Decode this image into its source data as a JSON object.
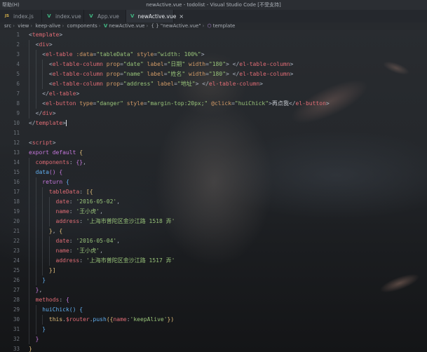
{
  "titlebar": {
    "menu": "帮助(H)",
    "window_title": "newActive.vue - todolist - Visual Studio Code [不受支持]"
  },
  "tabs": [
    {
      "label": "index.js",
      "icon": "js-file-icon",
      "active": false
    },
    {
      "label": "index.vue",
      "icon": "vue-file-icon",
      "active": false
    },
    {
      "label": "App.vue",
      "icon": "vue-file-icon",
      "active": false
    },
    {
      "label": "newActive.vue",
      "icon": "vue-file-icon",
      "active": true
    }
  ],
  "breadcrumb": {
    "items": [
      "src",
      "view",
      "keep-alive",
      "components"
    ],
    "file": "newActive.vue",
    "symbol_prefix": "{ }",
    "symbol": "\"newActive.vue\"",
    "last": "template"
  },
  "editor": {
    "lines": [
      {
        "n": "1",
        "tokens": [
          [
            "t-punc",
            "<"
          ],
          [
            "t-tag",
            "template"
          ],
          [
            "t-punc",
            ">"
          ]
        ]
      },
      {
        "n": "2",
        "tokens": [
          [
            "",
            "  "
          ],
          [
            "t-punc",
            "<"
          ],
          [
            "t-tag",
            "div"
          ],
          [
            "t-punc",
            ">"
          ]
        ]
      },
      {
        "n": "3",
        "tokens": [
          [
            "",
            "    "
          ],
          [
            "t-punc",
            "<"
          ],
          [
            "t-tag",
            "el-table"
          ],
          [
            "t-attr",
            " :data"
          ],
          [
            "t-punc",
            "="
          ],
          [
            "t-str",
            "\"tableData\""
          ],
          [
            "t-attr",
            " style"
          ],
          [
            "t-punc",
            "="
          ],
          [
            "t-str",
            "\"width: 100%\""
          ],
          [
            "t-punc",
            ">"
          ]
        ]
      },
      {
        "n": "4",
        "tokens": [
          [
            "",
            "      "
          ],
          [
            "t-punc",
            "<"
          ],
          [
            "t-tag",
            "el-table-column"
          ],
          [
            "t-attr",
            " prop"
          ],
          [
            "t-punc",
            "="
          ],
          [
            "t-str",
            "\"date\""
          ],
          [
            "t-attr",
            " label"
          ],
          [
            "t-punc",
            "="
          ],
          [
            "t-str",
            "\"日期\""
          ],
          [
            "t-attr",
            " width"
          ],
          [
            "t-punc",
            "="
          ],
          [
            "t-str",
            "\"180\""
          ],
          [
            "t-punc",
            "> </"
          ],
          [
            "t-tag",
            "el-table-column"
          ],
          [
            "t-punc",
            ">"
          ]
        ]
      },
      {
        "n": "5",
        "tokens": [
          [
            "",
            "      "
          ],
          [
            "t-punc",
            "<"
          ],
          [
            "t-tag",
            "el-table-column"
          ],
          [
            "t-attr",
            " prop"
          ],
          [
            "t-punc",
            "="
          ],
          [
            "t-str",
            "\"name\""
          ],
          [
            "t-attr",
            " label"
          ],
          [
            "t-punc",
            "="
          ],
          [
            "t-str",
            "\"姓名\""
          ],
          [
            "t-attr",
            " width"
          ],
          [
            "t-punc",
            "="
          ],
          [
            "t-str",
            "\"180\""
          ],
          [
            "t-punc",
            "> </"
          ],
          [
            "t-tag",
            "el-table-column"
          ],
          [
            "t-punc",
            ">"
          ]
        ]
      },
      {
        "n": "6",
        "tokens": [
          [
            "",
            "      "
          ],
          [
            "t-punc",
            "<"
          ],
          [
            "t-tag",
            "el-table-column"
          ],
          [
            "t-attr",
            " prop"
          ],
          [
            "t-punc",
            "="
          ],
          [
            "t-str",
            "\"address\""
          ],
          [
            "t-attr",
            " label"
          ],
          [
            "t-punc",
            "="
          ],
          [
            "t-str",
            "\"地址\""
          ],
          [
            "t-punc",
            "> </"
          ],
          [
            "t-tag",
            "el-table-column"
          ],
          [
            "t-punc",
            ">"
          ]
        ]
      },
      {
        "n": "7",
        "tokens": [
          [
            "",
            "    "
          ],
          [
            "t-punc",
            "</"
          ],
          [
            "t-tag",
            "el-table"
          ],
          [
            "t-punc",
            ">"
          ]
        ]
      },
      {
        "n": "8",
        "tokens": [
          [
            "",
            "    "
          ],
          [
            "t-punc",
            "<"
          ],
          [
            "t-tag",
            "el-button"
          ],
          [
            "t-attr",
            " type"
          ],
          [
            "t-punc",
            "="
          ],
          [
            "t-str",
            "\"danger\""
          ],
          [
            "t-attr",
            " style"
          ],
          [
            "t-punc",
            "="
          ],
          [
            "t-str",
            "\"margin-top:20px;\""
          ],
          [
            "t-attr",
            " @click"
          ],
          [
            "t-punc",
            "="
          ],
          [
            "t-str",
            "\"huiChick\""
          ],
          [
            "t-punc",
            ">"
          ],
          [
            "t-text",
            "再点我"
          ],
          [
            "t-punc",
            "</"
          ],
          [
            "t-tag",
            "el-button"
          ],
          [
            "t-punc",
            ">"
          ]
        ]
      },
      {
        "n": "9",
        "tokens": [
          [
            "",
            "  "
          ],
          [
            "t-punc",
            "</"
          ],
          [
            "t-tag",
            "div"
          ],
          [
            "t-punc",
            ">"
          ]
        ]
      },
      {
        "n": "10",
        "tokens": [
          [
            "t-punc",
            "</"
          ],
          [
            "t-tag",
            "template"
          ],
          [
            "t-punc t-cursor",
            ">"
          ]
        ]
      },
      {
        "n": "11",
        "tokens": []
      },
      {
        "n": "12",
        "tokens": [
          [
            "t-punc",
            "<"
          ],
          [
            "t-tag",
            "script"
          ],
          [
            "t-punc",
            ">"
          ]
        ]
      },
      {
        "n": "13",
        "tokens": [
          [
            "t-kw",
            "export default"
          ],
          [
            "t-punc",
            " "
          ],
          [
            "t-br1",
            "{"
          ]
        ]
      },
      {
        "n": "14",
        "tokens": [
          [
            "",
            "  "
          ],
          [
            "t-prop",
            "components"
          ],
          [
            "t-punc",
            ": "
          ],
          [
            "t-br2",
            "{}"
          ],
          [
            "t-punc",
            ","
          ]
        ]
      },
      {
        "n": "15",
        "tokens": [
          [
            "",
            "  "
          ],
          [
            "t-fn",
            "data"
          ],
          [
            "t-br2",
            "()"
          ],
          [
            "t-punc",
            " "
          ],
          [
            "t-br2",
            "{"
          ]
        ]
      },
      {
        "n": "16",
        "tokens": [
          [
            "",
            "    "
          ],
          [
            "t-kw",
            "return"
          ],
          [
            "t-punc",
            " "
          ],
          [
            "t-br3",
            "{"
          ]
        ]
      },
      {
        "n": "17",
        "tokens": [
          [
            "",
            "      "
          ],
          [
            "t-prop",
            "tableData"
          ],
          [
            "t-punc",
            ": "
          ],
          [
            "t-br1",
            "[{"
          ]
        ]
      },
      {
        "n": "18",
        "tokens": [
          [
            "",
            "        "
          ],
          [
            "t-prop",
            "date"
          ],
          [
            "t-punc",
            ": "
          ],
          [
            "t-str",
            "'2016-05-02'"
          ],
          [
            "t-punc",
            ","
          ]
        ]
      },
      {
        "n": "19",
        "tokens": [
          [
            "",
            "        "
          ],
          [
            "t-prop",
            "name"
          ],
          [
            "t-punc",
            ": "
          ],
          [
            "t-str",
            "'王小虎'"
          ],
          [
            "t-punc",
            ","
          ]
        ]
      },
      {
        "n": "20",
        "tokens": [
          [
            "",
            "        "
          ],
          [
            "t-prop",
            "address"
          ],
          [
            "t-punc",
            ": "
          ],
          [
            "t-str",
            "'上海市普陀区金沙江路 1518 弄'"
          ]
        ]
      },
      {
        "n": "21",
        "tokens": [
          [
            "",
            "      "
          ],
          [
            "t-br1",
            "}"
          ],
          [
            "t-punc",
            ", "
          ],
          [
            "t-br1",
            "{"
          ]
        ]
      },
      {
        "n": "22",
        "tokens": [
          [
            "",
            "        "
          ],
          [
            "t-prop",
            "date"
          ],
          [
            "t-punc",
            ": "
          ],
          [
            "t-str",
            "'2016-05-04'"
          ],
          [
            "t-punc",
            ","
          ]
        ]
      },
      {
        "n": "23",
        "tokens": [
          [
            "",
            "        "
          ],
          [
            "t-prop",
            "name"
          ],
          [
            "t-punc",
            ": "
          ],
          [
            "t-str",
            "'王小虎'"
          ],
          [
            "t-punc",
            ","
          ]
        ]
      },
      {
        "n": "24",
        "tokens": [
          [
            "",
            "        "
          ],
          [
            "t-prop",
            "address"
          ],
          [
            "t-punc",
            ": "
          ],
          [
            "t-str",
            "'上海市普陀区金沙江路 1517 弄'"
          ]
        ]
      },
      {
        "n": "25",
        "tokens": [
          [
            "",
            "      "
          ],
          [
            "t-br1",
            "}]"
          ]
        ]
      },
      {
        "n": "26",
        "tokens": [
          [
            "",
            "    "
          ],
          [
            "t-br3",
            "}"
          ]
        ]
      },
      {
        "n": "27",
        "tokens": [
          [
            "",
            "  "
          ],
          [
            "t-br2",
            "}"
          ],
          [
            "t-punc",
            ","
          ]
        ]
      },
      {
        "n": "28",
        "tokens": [
          [
            "",
            "  "
          ],
          [
            "t-prop",
            "methods"
          ],
          [
            "t-punc",
            ": "
          ],
          [
            "t-br2",
            "{"
          ]
        ]
      },
      {
        "n": "29",
        "tokens": [
          [
            "",
            "    "
          ],
          [
            "t-fn",
            "huiChick"
          ],
          [
            "t-br3",
            "()"
          ],
          [
            "t-punc",
            " "
          ],
          [
            "t-br3",
            "{"
          ]
        ]
      },
      {
        "n": "30",
        "tokens": [
          [
            "",
            "      "
          ],
          [
            "t-this",
            "this"
          ],
          [
            "t-punc",
            "."
          ],
          [
            "t-prop",
            "$router"
          ],
          [
            "t-punc",
            "."
          ],
          [
            "t-fn",
            "push"
          ],
          [
            "t-br1",
            "({"
          ],
          [
            "t-prop",
            "name"
          ],
          [
            "t-punc",
            ":"
          ],
          [
            "t-str",
            "'keepAlive'"
          ],
          [
            "t-br1",
            "})"
          ]
        ]
      },
      {
        "n": "31",
        "tokens": [
          [
            "",
            "    "
          ],
          [
            "t-br3",
            "}"
          ]
        ]
      },
      {
        "n": "32",
        "tokens": [
          [
            "",
            "  "
          ],
          [
            "t-br2",
            "}"
          ]
        ]
      },
      {
        "n": "33",
        "tokens": [
          [
            "t-br1",
            "}"
          ]
        ]
      }
    ]
  }
}
